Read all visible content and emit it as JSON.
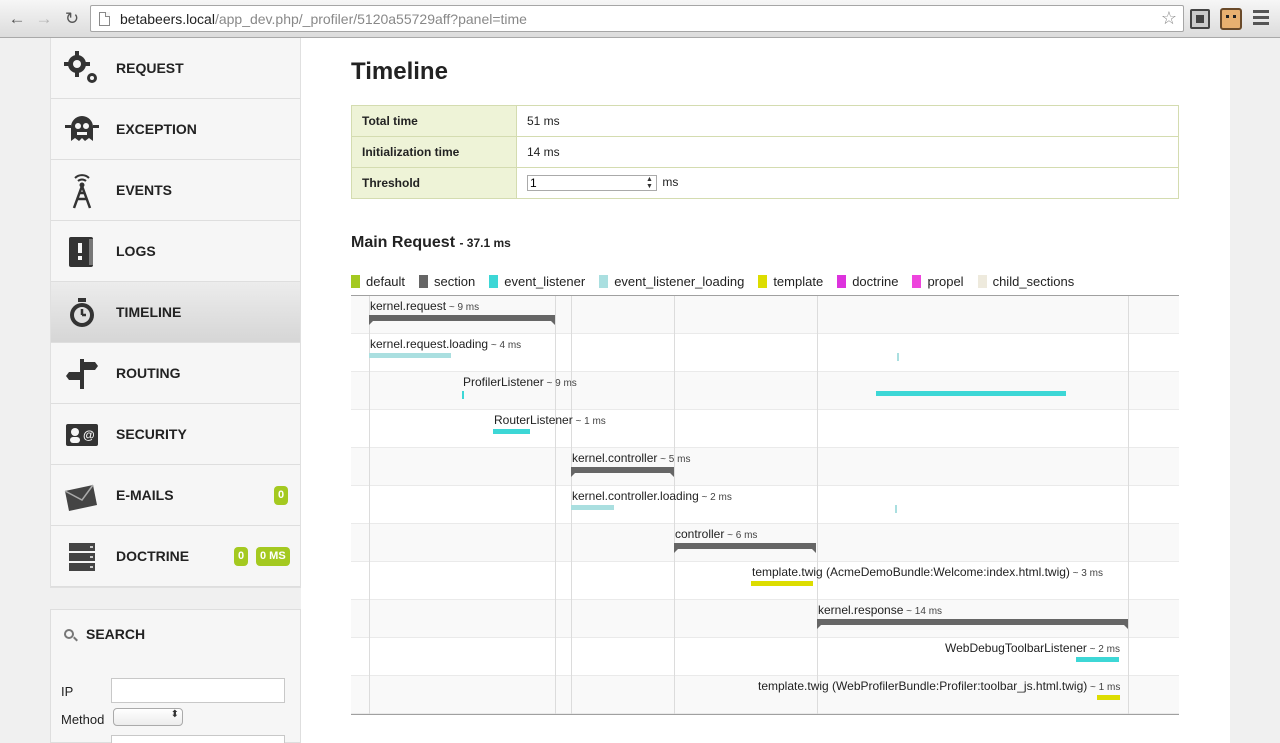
{
  "browser": {
    "url_host": "betabeers.local",
    "url_path": "/app_dev.php/_profiler/5120a55729aff?panel=time"
  },
  "sidebar": {
    "items": [
      {
        "label": "REQUEST",
        "icon": "gears-icon"
      },
      {
        "label": "EXCEPTION",
        "icon": "ghost-icon"
      },
      {
        "label": "EVENTS",
        "icon": "antenna-icon"
      },
      {
        "label": "LOGS",
        "icon": "log-book-icon"
      },
      {
        "label": "TIMELINE",
        "icon": "stopwatch-icon",
        "active": true
      },
      {
        "label": "ROUTING",
        "icon": "signpost-icon"
      },
      {
        "label": "SECURITY",
        "icon": "id-card-icon"
      },
      {
        "label": "E-MAILS",
        "icon": "envelope-icon",
        "badges": [
          "0"
        ]
      },
      {
        "label": "DOCTRINE",
        "icon": "database-icon",
        "badges": [
          "0",
          "0 MS"
        ]
      }
    ],
    "search": {
      "title": "SEARCH",
      "ip_label": "IP",
      "ip_value": "",
      "method_label": "Method",
      "method_value": ""
    }
  },
  "main": {
    "title": "Timeline",
    "summary": [
      {
        "label": "Total time",
        "value": "51 ms"
      },
      {
        "label": "Initialization time",
        "value": "14 ms"
      }
    ],
    "threshold": {
      "label": "Threshold",
      "value": "1",
      "unit": "ms"
    },
    "request_title": "Main Request",
    "request_duration": "- 37.1 ms",
    "legend": [
      {
        "name": "default",
        "color": "#a4c920"
      },
      {
        "name": "section",
        "color": "#666666"
      },
      {
        "name": "event_listener",
        "color": "#3dd7d6"
      },
      {
        "name": "event_listener_loading",
        "color": "#aadfe0"
      },
      {
        "name": "template",
        "color": "#dddd00"
      },
      {
        "name": "doctrine",
        "color": "#dd33dd"
      },
      {
        "name": "propel",
        "color": "#ee44dd"
      },
      {
        "name": "child_sections",
        "color": "#eeeadd"
      }
    ]
  },
  "timeline": {
    "events": [
      {
        "name": "kernel.request",
        "duration": "~ 9 ms",
        "category": "section",
        "periods": [
          [
            0.3,
            9.3
          ]
        ]
      },
      {
        "name": "kernel.request.loading",
        "duration": "~ 4 ms",
        "category": "event_listener_loading",
        "periods": [
          [
            0.3,
            4.3
          ],
          [
            25.9,
            25.9
          ]
        ]
      },
      {
        "name": "ProfilerListener",
        "duration": "~ 9 ms",
        "category": "event_listener",
        "periods": [
          [
            4.8,
            4.8
          ],
          [
            24.9,
            34.1
          ]
        ]
      },
      {
        "name": "RouterListener",
        "duration": "~ 1 ms",
        "category": "event_listener",
        "periods": [
          [
            6.3,
            8.1
          ]
        ]
      },
      {
        "name": "kernel.controller",
        "duration": "~ 5 ms",
        "category": "section",
        "periods": [
          [
            10.1,
            15.1
          ]
        ]
      },
      {
        "name": "kernel.controller.loading",
        "duration": "~ 2 ms",
        "category": "event_listener_loading",
        "periods": [
          [
            10.1,
            12.2
          ],
          [
            25.8,
            25.8
          ]
        ]
      },
      {
        "name": "controller",
        "duration": "~ 6 ms",
        "category": "section",
        "periods": [
          [
            15.1,
            22.0
          ]
        ]
      },
      {
        "name": "template.twig",
        "detail": "(AcmeDemoBundle:Welcome:index.html.twig)",
        "duration": "~ 3 ms",
        "category": "template",
        "periods": [
          [
            18.8,
            21.8
          ]
        ]
      },
      {
        "name": "kernel.response",
        "duration": "~ 14 ms",
        "category": "section",
        "periods": [
          [
            22.0,
            37.1
          ]
        ]
      },
      {
        "name": "WebDebugToolbarListener",
        "duration": "~ 2 ms",
        "category": "event_listener",
        "periods": [
          [
            34.6,
            36.7
          ]
        ]
      },
      {
        "name": "template.twig",
        "detail": "(WebProfilerBundle:Profiler:toolbar_js.html.twig)",
        "duration": "~ 1 ms",
        "category": "template",
        "periods": [
          [
            35.6,
            36.7
          ]
        ]
      }
    ],
    "scale_ms": 37.1,
    "markers_ms": [
      0.3,
      9.3,
      10.1,
      15.1,
      22.0,
      37.1
    ]
  }
}
